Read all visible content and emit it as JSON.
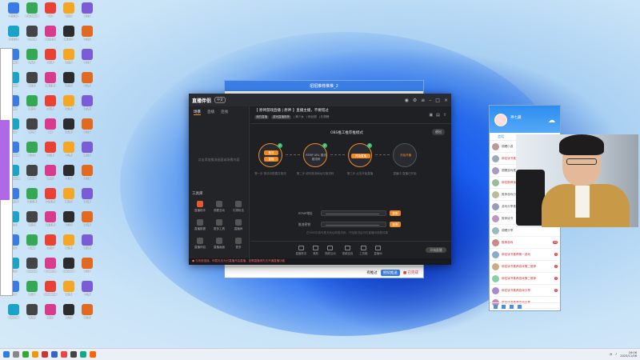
{
  "back_window": {
    "title": "招招推荐推推_2",
    "footer_btn_1": "有推过",
    "footer_btn_2": "继续推送",
    "footer_btn_3": "■ 已完成"
  },
  "app": {
    "logo": "直播伴侣",
    "version_badge": "中文",
    "left_tabs": [
      "场景",
      "直播",
      "连线"
    ],
    "left_hint": "点击添加推流画面或场景内容",
    "tools_title": "工具库",
    "tools": [
      {
        "label": "直播助手",
        "hot": true
      },
      {
        "label": "观看互动",
        "hot": false
      },
      {
        "label": "礼物玩法",
        "hot": false
      },
      {
        "label": "直播数据",
        "hot": false
      },
      {
        "label": "更多工具",
        "hot": false
      },
      {
        "label": "直播间",
        "hot": false
      },
      {
        "label": "直播伴侣",
        "hot": false
      },
      {
        "label": "直播画面",
        "hot": false
      },
      {
        "label": "更多",
        "hot": false
      }
    ],
    "room_title": "【 原神游戏直播 | 原神 】直播主播，不要错过",
    "room_chip_1": "我的直播",
    "room_chip_2": "游戏直播推荐",
    "room_meta_1": "| 美少女",
    "room_meta_2": "| 粉丝团",
    "room_meta_3": "| 礼物榜",
    "obs_title": "OBS推工推荐推模式",
    "exit_btn": "退出",
    "steps": [
      {
        "pill_top": "推流",
        "pill_bottom": "直播",
        "desc": "第一步 推流中配置并推流"
      },
      {
        "pill_top": "",
        "pill_bottom": "",
        "label": "RTMP URL 推流 推流码",
        "desc": "第二步 填写推流地址与推流码"
      },
      {
        "pill_top": "开始直播",
        "pill_bottom": "",
        "desc": "第三步 点击开始直播"
      },
      {
        "pill_top": "",
        "pill_bottom": "",
        "label": "开始开播",
        "desc": "直播中 直播已开始"
      }
    ],
    "field_1_label": "RTMP地址",
    "field_1_btn": "复制",
    "field_2_label": "推流密钥",
    "field_2_btn": "复制",
    "obs_note": "在OBS中填写推流地址和推流码，开始推流后可在直播间观看效果",
    "bottom_items": [
      "直播推流",
      "美颜",
      "视频互动",
      "视频连线",
      "工具箱",
      "直播间"
    ],
    "start_btn": "开始直播",
    "status": "● 与系统连接，你暂无法为已直播开启直播，如需直播请先去开通直播功能"
  },
  "qq": {
    "name": "神七藏",
    "tab": "会话",
    "rows": [
      {
        "text": "锦鲤小游",
        "plain": true,
        "count": ""
      },
      {
        "text": "绑定读书推荐游戏分享",
        "plain": false,
        "count": "2"
      },
      {
        "text": "锦鲤游戏推荐",
        "plain": true,
        "count": ""
      },
      {
        "text": "绑定推荐读书推荐",
        "plain": false,
        "count": ""
      },
      {
        "text": "推荐游戏分享读书",
        "plain": true,
        "count": ""
      },
      {
        "text": "游戏分享推荐",
        "plain": true,
        "count": ""
      },
      {
        "text": "推荐读书",
        "plain": true,
        "count": ""
      },
      {
        "text": "锦鲤分享",
        "plain": true,
        "count": ""
      },
      {
        "text": "推荐游戏",
        "plain": false,
        "count": "99"
      },
      {
        "text": "绑定读书推荐第一游戏",
        "plain": false,
        "count": "1"
      },
      {
        "text": "绑定读书推荐游戏第二推荐",
        "plain": false,
        "count": "1"
      },
      {
        "text": "绑定读书推荐游戏第二推荐",
        "plain": false,
        "count": "1"
      },
      {
        "text": "绑定读书推荐游戏分享",
        "plain": false,
        "count": "1"
      },
      {
        "text": "绑定读书推荐游戏分享",
        "plain": false,
        "count": ""
      }
    ]
  },
  "desktop_icons": [
    "此电脑",
    "PyCharm",
    "QQ",
    "网络",
    "文档",
    "回收站",
    "Office",
    "QQ音乐",
    "网易云",
    "表格",
    "Steam",
    "腾讯",
    "游戏",
    "原神",
    "文件",
    "Steam",
    "网易",
    "播放器",
    "视频",
    "工具",
    "Edge",
    "微信",
    "游戏",
    "录屏",
    "表格",
    "剪映",
    "WPS",
    "Go",
    "直播",
    "文件",
    "Tencent",
    "钉钉",
    "游戏",
    "工具",
    "软件",
    "WeGame",
    "Zoom",
    "腾讯",
    "文件",
    "文件",
    "编辑器",
    "浏览器",
    "文件夹",
    "截图",
    "游戏",
    "设置",
    "网盘",
    "浏览器",
    "文档",
    "游戏",
    "应用",
    "Alist",
    "视频",
    "影音",
    "收藏",
    "地图",
    "Google",
    "Chrome",
    "DaVinci",
    "文件",
    "天气",
    "助手",
    "Windows",
    "录音",
    "工具",
    "CapCut",
    "剪辑",
    "音乐",
    "文档",
    "设置"
  ],
  "clock": {
    "time": "16:06",
    "date": "2023/11/06"
  }
}
